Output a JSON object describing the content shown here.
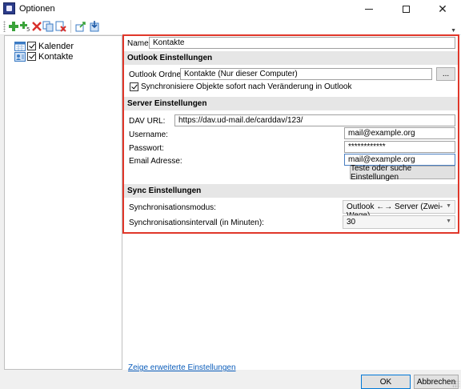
{
  "window": {
    "title": "Optionen",
    "minimize": "—",
    "maximize": "☐",
    "close": "✕"
  },
  "toolbar": {
    "icons": [
      "add-icon",
      "add-multiple-icon",
      "delete-icon",
      "copy-icon",
      "clear-cache-icon",
      "export-icon",
      "import-icon"
    ]
  },
  "tree": {
    "items": [
      {
        "label": "Kalender",
        "checked": true,
        "icon": "calendar-icon"
      },
      {
        "label": "Kontakte",
        "checked": true,
        "icon": "contacts-icon"
      }
    ]
  },
  "form": {
    "name_label": "Name:",
    "name_value": "Kontakte",
    "outlook_section": "Outlook Einstellungen",
    "outlook_folder_label": "Outlook Ordner:",
    "outlook_folder_value": "Kontakte (Nur dieser Computer)",
    "browse_label": "...",
    "sync_checkbox_label": "Synchronisiere Objekte sofort nach Veränderung in Outlook",
    "server_section": "Server Einstellungen",
    "dav_url_label": "DAV URL:",
    "dav_url_value": "https://dav.ud-mail.de/carddav/123/",
    "username_label": "Username:",
    "username_value": "mail@example.org",
    "password_label": "Passwort:",
    "password_value": "************",
    "email_label": "Email Adresse:",
    "email_value": "mail@example.org",
    "test_button": "Teste oder suche Einstellungen",
    "sync_section": "Sync Einstellungen",
    "sync_mode_label": "Synchronisationsmodus:",
    "sync_mode_value": "Outlook ←→ Server (Zwei-Wege)",
    "sync_interval_label": "Synchronisationsintervall (in Minuten):",
    "sync_interval_value": "30"
  },
  "footer": {
    "advanced_link": "Zeige erweiterte Einstellungen",
    "ok": "OK",
    "cancel": "Abbrechen"
  },
  "colors": {
    "highlight_border": "#e0372a",
    "link": "#0b5dbb",
    "section_bg": "#e6e6e6"
  }
}
